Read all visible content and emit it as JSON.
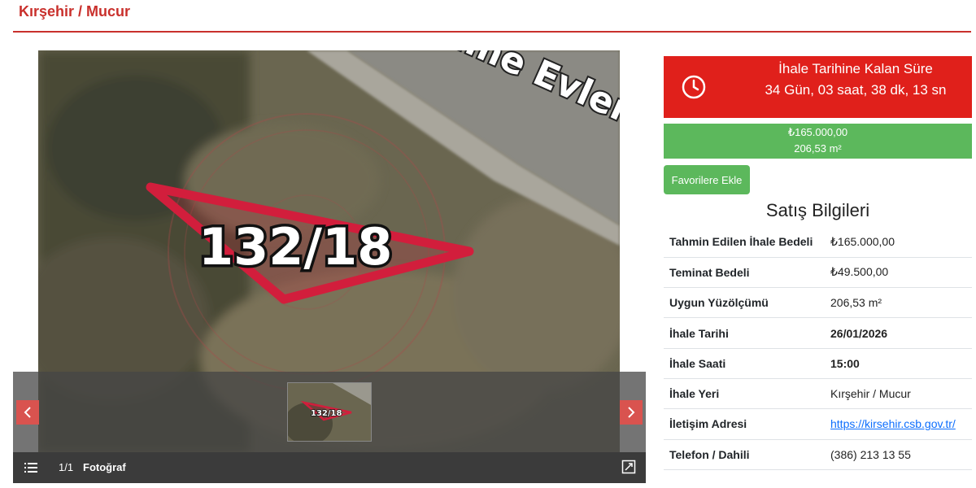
{
  "header": {
    "title": "Kırşehir / Mucur"
  },
  "gallery": {
    "photo_label": "132/18",
    "map_text": "Tıme Evler",
    "counter": "1/1",
    "label": "Fotoğraf",
    "prev_icon": "chevron-left-icon",
    "next_icon": "chevron-right-icon",
    "menu_icon": "list-icon",
    "fullscreen_icon": "fullscreen-icon"
  },
  "countdown": {
    "title": "İhale Tarihine Kalan Süre",
    "time": "34 Gün, 03 saat, 38 dk, 13 sn",
    "icon": "clock-icon",
    "color": "#e0201b"
  },
  "price": {
    "amount": "₺165.000,00",
    "area": "206,53 m²",
    "color": "#5cb85c"
  },
  "favorite_button": "Favorilere Ekle",
  "sales": {
    "title": "Satış Bilgileri",
    "rows": [
      {
        "label": "Tahmin Edilen İhale Bedeli",
        "value": "₺165.000,00"
      },
      {
        "label": "Teminat Bedeli",
        "value": "₺49.500,00"
      },
      {
        "label": "Uygun Yüzölçümü",
        "value": "206,53 m²"
      },
      {
        "label": "İhale Tarihi",
        "value": "26/01/2026"
      },
      {
        "label": "İhale Saati",
        "value": "15:00"
      },
      {
        "label": "İhale Yeri",
        "value": "Kırşehir / Mucur"
      },
      {
        "label": "İletişim Adresi",
        "value": "https://kirsehir.csb.gov.tr/"
      },
      {
        "label": "Telefon / Dahili",
        "value": "(386) 213 13 55"
      }
    ]
  }
}
